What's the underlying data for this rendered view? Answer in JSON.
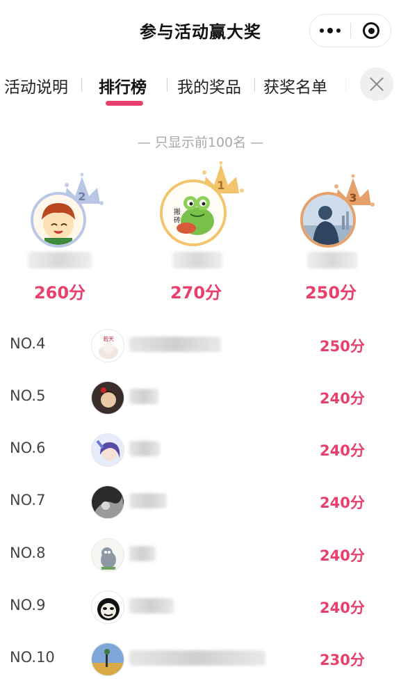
{
  "header": {
    "title": "参与活动赢大奖",
    "more_icon": "more-dots-icon",
    "close_icon": "target-close-icon"
  },
  "tabs": [
    {
      "label": "活动说明"
    },
    {
      "label": "排行榜"
    },
    {
      "label": "我的奖品"
    },
    {
      "label": "获奖名单"
    }
  ],
  "active_tab": "排行榜",
  "notice": "— 只显示前100名 —",
  "accent_color": "#e8406c",
  "podium": [
    {
      "rank": "2",
      "score": "260分",
      "crown_color": "#b9c6e6"
    },
    {
      "rank": "1",
      "score": "270分",
      "crown_color": "#f3c46b"
    },
    {
      "rank": "3",
      "score": "250分",
      "crown_color": "#e6a06a"
    }
  ],
  "list": [
    {
      "rank": "NO.4",
      "score": "250分"
    },
    {
      "rank": "NO.5",
      "score": "240分"
    },
    {
      "rank": "NO.6",
      "score": "240分"
    },
    {
      "rank": "NO.7",
      "score": "240分"
    },
    {
      "rank": "NO.8",
      "score": "240分"
    },
    {
      "rank": "NO.9",
      "score": "240分"
    },
    {
      "rank": "NO.10",
      "score": "230分"
    }
  ]
}
